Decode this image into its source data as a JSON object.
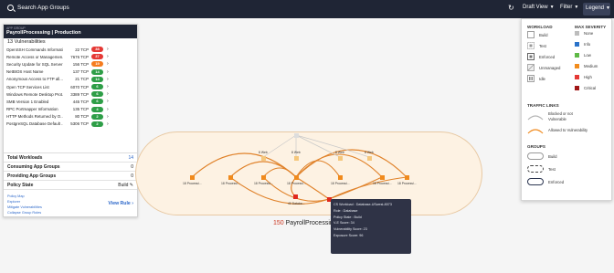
{
  "topbar": {
    "search_text": "Search App Groups",
    "draft_view": "Draft View",
    "filter": "Filter",
    "legend": "Legend"
  },
  "panel": {
    "eyebrow": "APP GROUP",
    "title": "PayrollProcessing | Production",
    "vuln_count": "13 Vulnerabilities",
    "vulnerabilities": [
      {
        "name": "OpenSSH Commands Informati...",
        "port": "22 TCP",
        "score": "38",
        "color": "#e53935"
      },
      {
        "name": "Remote Access or Managemen...",
        "port": "7676 TCP",
        "score": "37",
        "color": "#e53935"
      },
      {
        "name": "Security Update for SQL Server",
        "port": "156 TCP",
        "score": "19",
        "color": "#f57c1f"
      },
      {
        "name": "NetBIOS Host Name",
        "port": "137 TCP",
        "score": "14",
        "color": "#2e9e47"
      },
      {
        "name": "Anonymous Access to FTP all...",
        "port": "21 TCP",
        "score": "14",
        "color": "#2e9e47"
      },
      {
        "name": "Open TCP Services List",
        "port": "6070 TCP",
        "score": "6",
        "color": "#2e9e47"
      },
      {
        "name": "Windows Remote Desktop Prot...",
        "port": "3389 TCP",
        "score": "6",
        "color": "#2e9e47"
      },
      {
        "name": "SMB Version 1 Enabled",
        "port": "445 TCP",
        "score": "6",
        "color": "#2e9e47"
      },
      {
        "name": "RPC Portmapper Information",
        "port": "135 TCP",
        "score": "4",
        "color": "#2e9e47"
      },
      {
        "name": "HTTP Methods Returned by O...",
        "port": "80 TCP",
        "score": "2",
        "color": "#2e9e47"
      },
      {
        "name": "PostgreSQL Database Default ...",
        "port": "5306 TCP",
        "score": "2",
        "color": "#2e9e47"
      }
    ],
    "stats": [
      {
        "label": "Total Workloads",
        "value": "14"
      },
      {
        "label": "Consuming App Groups",
        "value": "0"
      },
      {
        "label": "Providing App Groups",
        "value": "0"
      },
      {
        "label": "Policy State",
        "value": "Build"
      }
    ],
    "links": [
      "Policy Map",
      "Explorer",
      "Mitigate Vulnerabilities",
      "Collapse Group Roles"
    ],
    "view_rule": "View Rule"
  },
  "graph": {
    "group_count": "150",
    "group_name": "PayrollProcessing | ...",
    "nodes": [
      {
        "label": "",
        "color": "#dddddd"
      },
      {
        "label": "8 Web",
        "color": "#f5c77c"
      },
      {
        "label": "8 Web",
        "color": "#f5c77c"
      },
      {
        "label": "8 Web",
        "color": "#f5c77c"
      },
      {
        "label": "8 Web",
        "color": "#f5c77c"
      },
      {
        "label": "18 Processi...",
        "color": "#f08a1d"
      },
      {
        "label": "18 Processi...",
        "color": "#f08a1d"
      },
      {
        "label": "18 Processi...",
        "color": "#f08a1d"
      },
      {
        "label": "18 Processi...",
        "color": "#f08a1d"
      },
      {
        "label": "18 Processi...",
        "color": "#f08a1d"
      },
      {
        "label": "18 Processi...",
        "color": "#f08a1d"
      },
      {
        "label": "18 Processi...",
        "color": "#f08a1d"
      },
      {
        "label": "40 Databa...",
        "color": "#e0281d"
      },
      {
        "label": "",
        "color": "#e0281d"
      }
    ]
  },
  "tooltip": {
    "lines": [
      "CS Workload : Database-USwest-8073",
      "Role : Database",
      "Policy State : Build",
      "V-E Score: 34",
      "Vulnerability Score: 23",
      "Exposure Score: 96"
    ]
  },
  "legend": {
    "workload_title": "WORKLOAD",
    "severity_title": "MAX SEVERITY",
    "workload_items": [
      "Build",
      "Test",
      "Enforced",
      "Unmanaged",
      "Idle"
    ],
    "severity_items": [
      {
        "label": "None",
        "color": "#bdbdbd"
      },
      {
        "label": "Info",
        "color": "#2a72c9"
      },
      {
        "label": "Low",
        "color": "#5fb946"
      },
      {
        "label": "Medium",
        "color": "#f28c1c"
      },
      {
        "label": "High",
        "color": "#e53935"
      },
      {
        "label": "Critical",
        "color": "#a01616"
      }
    ],
    "traffic_title": "TRAFFIC LINKS",
    "traffic_items": [
      {
        "label": "Blocked or not Vulnerable",
        "color": "#b5b5b5"
      },
      {
        "label": "Allowed to Vulnerability",
        "color": "#f08a1d"
      }
    ],
    "groups_title": "GROUPS",
    "group_items": [
      "Build",
      "Test",
      "Enforced"
    ]
  }
}
